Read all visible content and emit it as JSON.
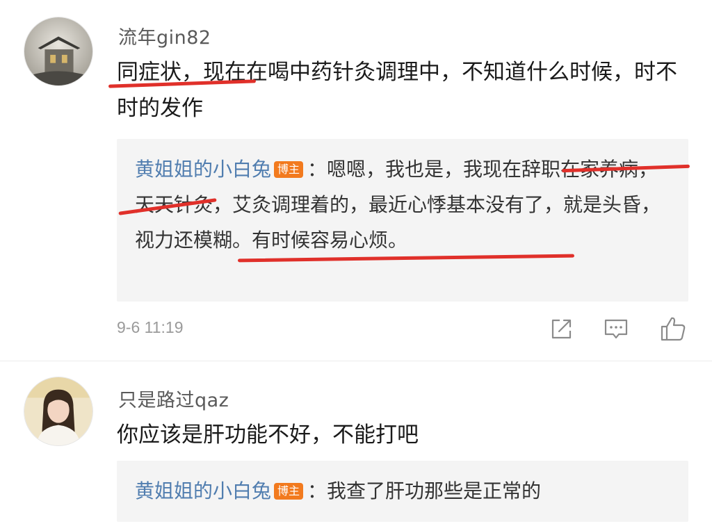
{
  "comments": [
    {
      "username": "流年gin82",
      "text": "同症状，现在在喝中药针灸调理中，不知道什么时候，时不时的发作",
      "reply": {
        "author": "黄姐姐的小白兔",
        "badge": "博主",
        "text": "：嗯嗯，我也是，我现在辞职在家养病，天天针灸，艾灸调理着的，最近心悸基本没有了，就是头昏，视力还模糊。有时候容易心烦。"
      },
      "time": "9-6 11:19"
    },
    {
      "username": "只是路过qaz",
      "text": "你应该是肝功能不好，不能打吧",
      "reply": {
        "author": "黄姐姐的小白兔",
        "badge": "博主",
        "text": "：我查了肝功那些是正常的"
      }
    }
  ],
  "icons": {
    "share": "share-icon",
    "reply": "comment-icon",
    "like": "thumbs-up-icon"
  },
  "colors": {
    "username": "#5a5a5a",
    "reply_author": "#507daf",
    "badge": "#f27a1e",
    "reply_background": "#f4f4f4",
    "annotation": "#e0302a"
  }
}
